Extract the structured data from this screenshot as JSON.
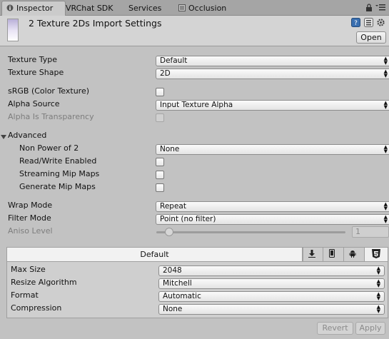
{
  "tabs": [
    {
      "label": "Inspector",
      "icon": "info-icon",
      "active": true
    },
    {
      "label": "VRChat SDK",
      "active": false
    },
    {
      "label": "Services",
      "active": false
    },
    {
      "label": "Occlusion",
      "icon": "occlusion-icon",
      "active": false
    }
  ],
  "header": {
    "title": "2 Texture 2Ds Import Settings",
    "open_label": "Open"
  },
  "fields": {
    "texture_type": {
      "label": "Texture Type",
      "value": "Default"
    },
    "texture_shape": {
      "label": "Texture Shape",
      "value": "2D"
    },
    "srgb": {
      "label": "sRGB (Color Texture)",
      "checked": false
    },
    "alpha_source": {
      "label": "Alpha Source",
      "value": "Input Texture Alpha"
    },
    "alpha_transparency": {
      "label": "Alpha Is Transparency",
      "checked": false,
      "disabled": true
    },
    "advanced": {
      "label": "Advanced",
      "expanded": true
    },
    "npot": {
      "label": "Non Power of 2",
      "value": "None"
    },
    "read_write": {
      "label": "Read/Write Enabled",
      "checked": false
    },
    "streaming_mips": {
      "label": "Streaming Mip Maps",
      "checked": false
    },
    "generate_mips": {
      "label": "Generate Mip Maps",
      "checked": false
    },
    "wrap_mode": {
      "label": "Wrap Mode",
      "value": "Repeat"
    },
    "filter_mode": {
      "label": "Filter Mode",
      "value": "Point (no filter)"
    },
    "aniso": {
      "label": "Aniso Level",
      "value": "1",
      "disabled": true
    }
  },
  "platform": {
    "default_tab": "Default",
    "icons": [
      "download-icon",
      "mobile-icon",
      "android-icon",
      "html5-icon"
    ],
    "max_size": {
      "label": "Max Size",
      "value": "2048"
    },
    "resize": {
      "label": "Resize Algorithm",
      "value": "Mitchell"
    },
    "format": {
      "label": "Format",
      "value": "Automatic"
    },
    "compression": {
      "label": "Compression",
      "value": "None"
    }
  },
  "footer": {
    "revert_label": "Revert",
    "apply_label": "Apply"
  }
}
